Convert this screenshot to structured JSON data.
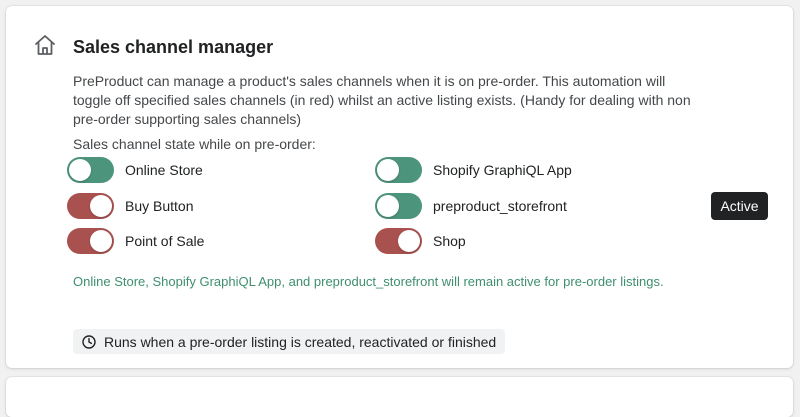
{
  "section": {
    "title": "Sales channel manager",
    "description": "PreProduct can manage a product's sales channels when it is on pre-order. This automation will toggle off specified sales channels (in red) whilst an active listing exists. (Handy for dealing with non pre-order supporting sales channels)",
    "icon": "home-icon"
  },
  "state_label": "Sales channel state while on pre-order:",
  "channels": [
    {
      "label": "Online Store",
      "state": "on",
      "color": "#4d947c"
    },
    {
      "label": "Buy Button",
      "state": "off",
      "color": "#a8514f"
    },
    {
      "label": "Point of Sale",
      "state": "off",
      "color": "#a8514f"
    },
    {
      "label": "Shopify GraphiQL App",
      "state": "on",
      "color": "#4d947c"
    },
    {
      "label": "preproduct_storefront",
      "state": "on",
      "color": "#4d947c"
    },
    {
      "label": "Shop",
      "state": "off",
      "color": "#a8514f"
    }
  ],
  "status_badge": "Active",
  "result_note": "Online Store, Shopify GraphiQL App, and preproduct_storefront will remain active for pre-order listings.",
  "trigger_note": "Runs when a pre-order listing is created, reactivated or finished",
  "trigger_icon": "clock-icon",
  "colors": {
    "on": "#4d947c",
    "off": "#a8514f",
    "note_text": "#3f8f6f",
    "badge_bg": "#202223"
  }
}
